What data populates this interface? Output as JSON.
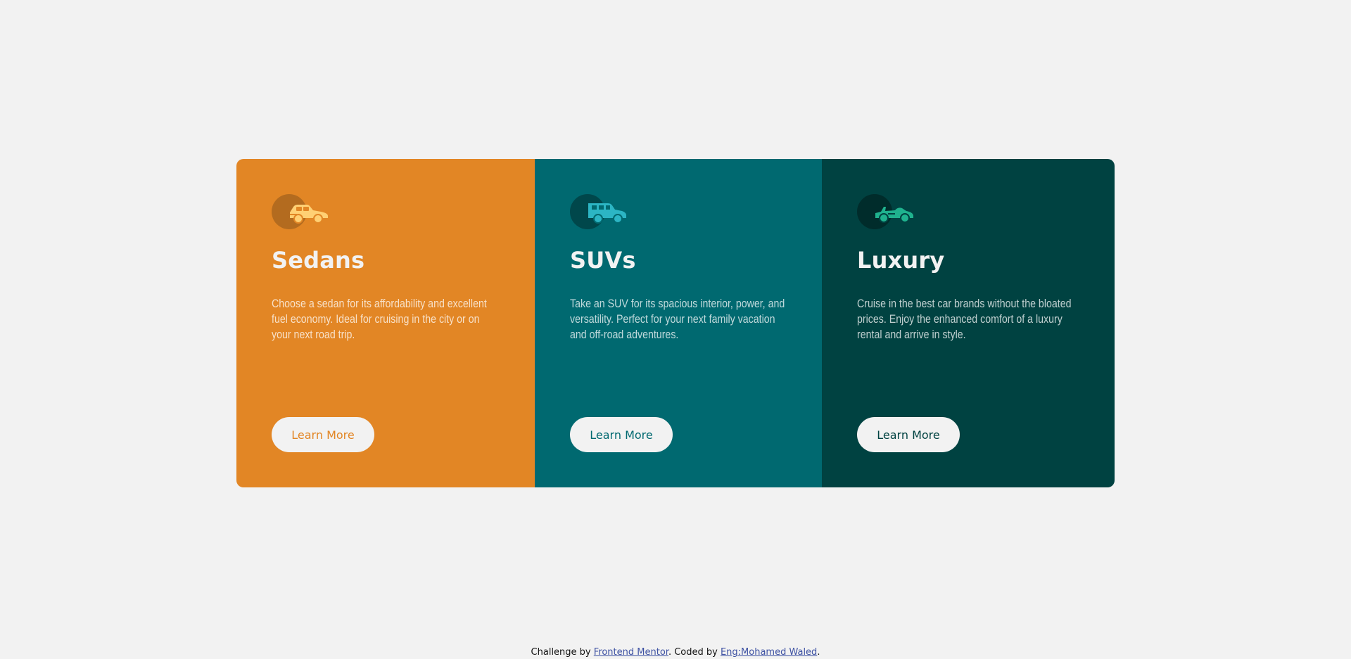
{
  "cards": [
    {
      "id": "sedans",
      "icon": "sedan-car-icon",
      "title": "Sedans",
      "text": "Choose a sedan for its affordability and excellent fuel economy. Ideal for cruising in the city or on your next road trip.",
      "button_label": "Learn More",
      "color": "#e28625",
      "icon_color": "#ffd074"
    },
    {
      "id": "suvs",
      "icon": "suv-car-icon",
      "title": "SUVs",
      "text": "Take an SUV for its spacious interior, power, and versatility. Perfect for your next family vacation and off-road adventures.",
      "button_label": "Learn More",
      "color": "#006970",
      "icon_color": "#2cb5c4"
    },
    {
      "id": "luxury",
      "icon": "luxury-car-icon",
      "title": "Luxury",
      "text": "Cruise in the best car brands without the bloated prices. Enjoy the enhanced comfort of a luxury rental and arrive in style.",
      "button_label": "Learn More",
      "color": "#004241",
      "icon_color": "#1fb28e"
    }
  ],
  "attribution": {
    "prefix": "Challenge by ",
    "link1": "Frontend Mentor",
    "middle": ". Coded by ",
    "link2": "Eng:Mohamed Waled",
    "suffix": "."
  }
}
